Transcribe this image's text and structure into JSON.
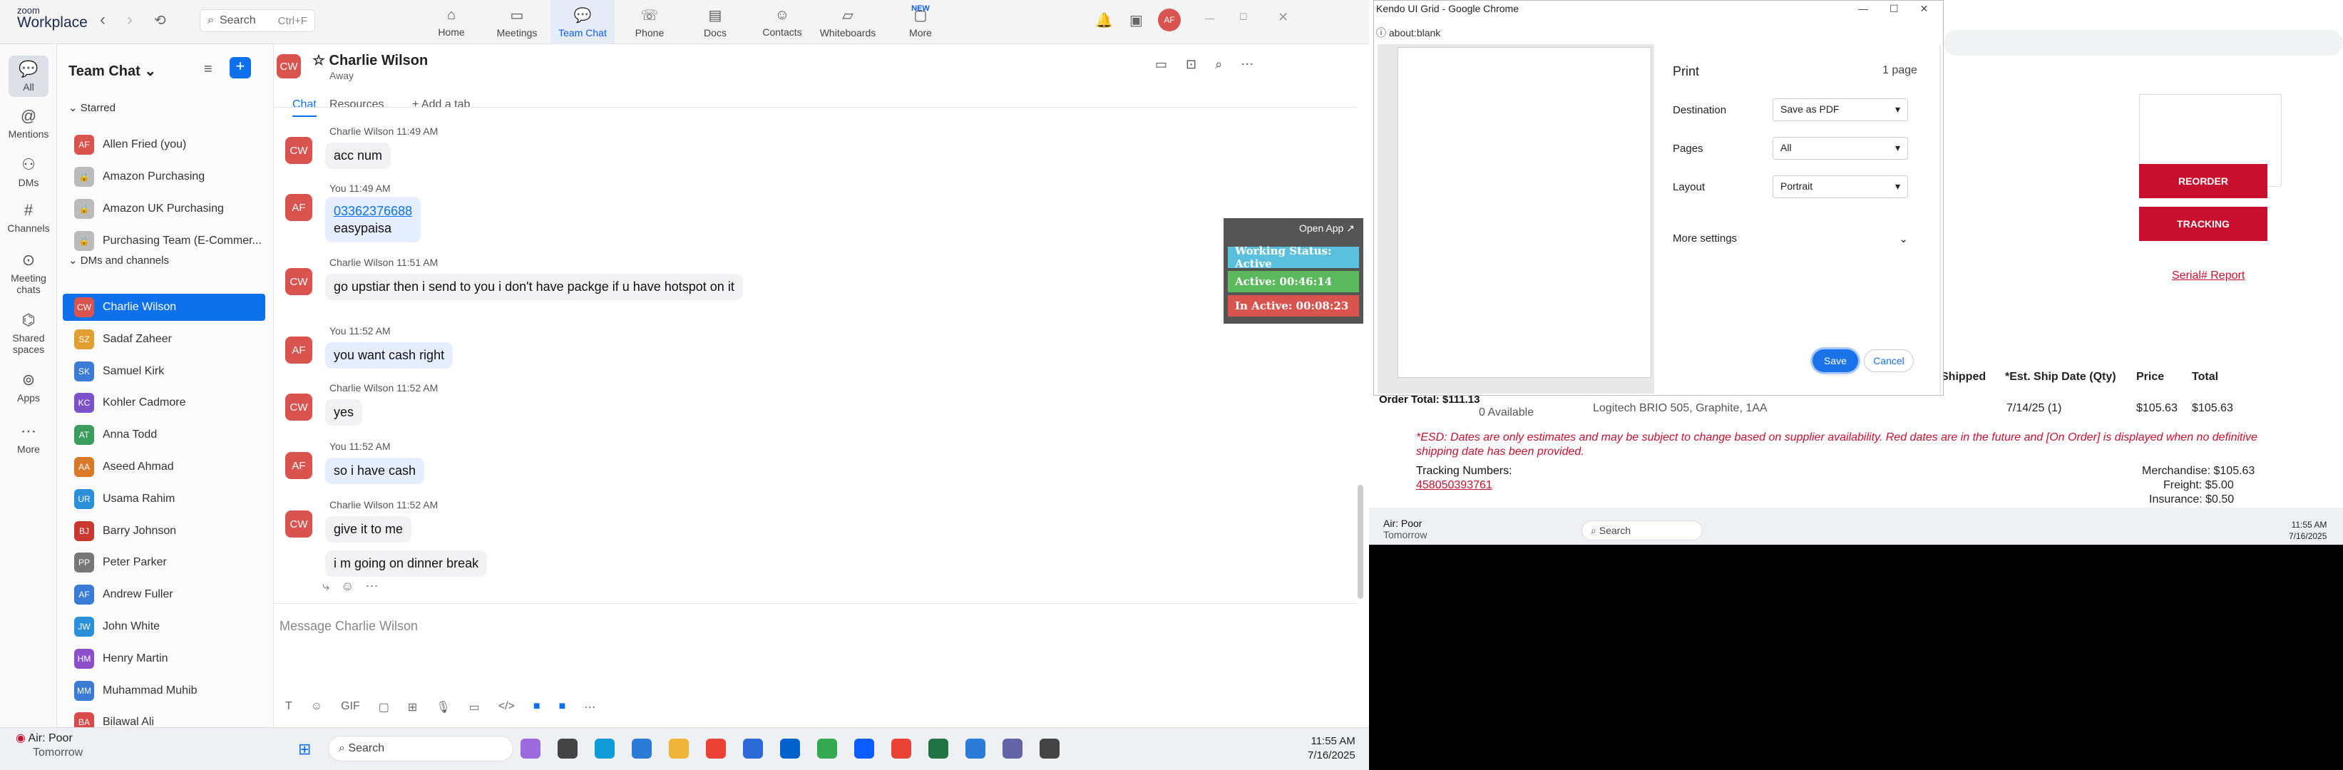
{
  "app": {
    "logo_top": "zoom",
    "logo_bottom": "Workplace",
    "search_placeholder": "Search",
    "search_shortcut": "Ctrl+F",
    "avatar": "AF"
  },
  "nav": [
    "Home",
    "Meetings",
    "Team Chat",
    "Phone",
    "Docs",
    "Contacts",
    "Whiteboards",
    "More"
  ],
  "nav_new": "NEW",
  "rail": [
    "All",
    "Mentions",
    "DMs",
    "Channels",
    "Meeting chats",
    "Shared spaces",
    "Apps",
    "More"
  ],
  "list": {
    "title": "Team Chat",
    "starred_label": "Starred",
    "dms_label": "DMs and channels",
    "starred": [
      {
        "ini": "AF",
        "name": "Allen Fried (you)",
        "color": "#d9534f"
      },
      {
        "ini": "🔒",
        "name": "Amazon Purchasing",
        "color": "#bbb"
      },
      {
        "ini": "🔒",
        "name": "Amazon UK Purchasing",
        "color": "#bbb"
      },
      {
        "ini": "🔒",
        "name": "Purchasing Team (E-Commer...",
        "color": "#bbb"
      }
    ],
    "dms": [
      {
        "ini": "CW",
        "name": "Charlie Wilson",
        "color": "#d9534f"
      },
      {
        "ini": "SZ",
        "name": "Sadaf Zaheer",
        "color": "#e0a030"
      },
      {
        "ini": "SK",
        "name": "Samuel Kirk",
        "color": "#3a7bd5"
      },
      {
        "ini": "KC",
        "name": "Kohler Cadmore",
        "color": "#7b52c9"
      },
      {
        "ini": "AT",
        "name": "Anna Todd",
        "color": "#3c9c5c"
      },
      {
        "ini": "AA",
        "name": "Aseed Ahmad",
        "color": "#d97a2b"
      },
      {
        "ini": "UR",
        "name": "Usama Rahim",
        "color": "#2b8fd9"
      },
      {
        "ini": "BJ",
        "name": "Barry Johnson",
        "color": "#c9382f"
      },
      {
        "ini": "PP",
        "name": "Peter Parker",
        "color": "#777"
      },
      {
        "ini": "AF",
        "name": "Andrew Fuller",
        "color": "#3a7bd5"
      },
      {
        "ini": "JW",
        "name": "John White",
        "color": "#2b8fd9"
      },
      {
        "ini": "HM",
        "name": "Henry Martin",
        "color": "#8a4fc9"
      },
      {
        "ini": "MM",
        "name": "Muhammad Muhib",
        "color": "#3a7bd5"
      },
      {
        "ini": "BA",
        "name": "Bilawal Ali",
        "color": "#d94b4b"
      }
    ]
  },
  "chat": {
    "name": "Charlie Wilson",
    "status": "Away",
    "tabs": [
      "Chat",
      "Resources",
      "Add a tab"
    ],
    "messages": [
      {
        "who": "CW",
        "head": "Charlie Wilson 11:49 AM",
        "texts": [
          "acc num"
        ]
      },
      {
        "who": "AF",
        "head": "You 11:49 AM",
        "texts": [
          "03362376688",
          "easypaisa"
        ]
      },
      {
        "who": "CW",
        "head": "Charlie Wilson 11:51 AM",
        "texts": [
          "go upstiar then i send to you i don't have packge if u have hotspot on it"
        ]
      },
      {
        "who": "AF",
        "head": "You 11:52 AM",
        "texts": [
          "you want cash right"
        ]
      },
      {
        "who": "CW",
        "head": "Charlie Wilson 11:52 AM",
        "texts": [
          "yes"
        ]
      },
      {
        "who": "AF",
        "head": "You 11:52 AM",
        "texts": [
          "so i have cash"
        ]
      },
      {
        "who": "CW",
        "head": "Charlie Wilson 11:52 AM",
        "texts": [
          "give it to me",
          "i m going on dinner break"
        ]
      }
    ],
    "input_placeholder": "Message Charlie Wilson"
  },
  "widget": {
    "open": "Open App ↗",
    "working": "Working Status: Active",
    "active": "Active: 00:46:14",
    "inactive": "In Active: 00:08:23"
  },
  "taskbar": {
    "weather": "Air: Poor",
    "weather_sub": "Tomorrow",
    "search": "Search",
    "time": "11:55 AM",
    "date": "7/16/2025"
  },
  "chrome": {
    "title": "Kendo UI Grid - Google Chrome",
    "url": "about:blank",
    "print": "Print",
    "pages_count": "1 page",
    "destination_label": "Destination",
    "destination": "Save as PDF",
    "pages_label": "Pages",
    "pages": "All",
    "layout_label": "Layout",
    "layout": "Portrait",
    "more": "More settings",
    "save": "Save",
    "cancel": "Cancel"
  },
  "bg": {
    "reorder": "REORDER",
    "tracking": "TRACKING",
    "serial": "Serial# Report",
    "cols": [
      "Shipped",
      "*Est. Ship Date (Qty)",
      "Price",
      "Total"
    ],
    "row": {
      "qty": "10",
      "avail": "0 Available",
      "item": "Logitech BRIO 505, Graphite, 1AA",
      "n1": "1",
      "n2": "1",
      "date": "7/14/25 (1)",
      "price": "$105.63",
      "total": "$105.63"
    },
    "esd": "*ESD: Dates are only estimates and may be subject to change based on supplier availability. Red dates are in the future and [On Order] is displayed when no definitive shipping date has been provided.",
    "tracking_label": "Tracking Numbers:",
    "tracking_num": "458050393761",
    "order_total": "Order Total: $111.13",
    "merch": "Merchandise: $105.63",
    "freight": "Freight: $5.00",
    "ins": "Insurance: $0.50"
  },
  "taskbar2": {
    "weather": "Air: Poor",
    "weather_sub": "Tomorrow",
    "search": "Search",
    "time": "11:55 AM",
    "date": "7/16/2025"
  }
}
